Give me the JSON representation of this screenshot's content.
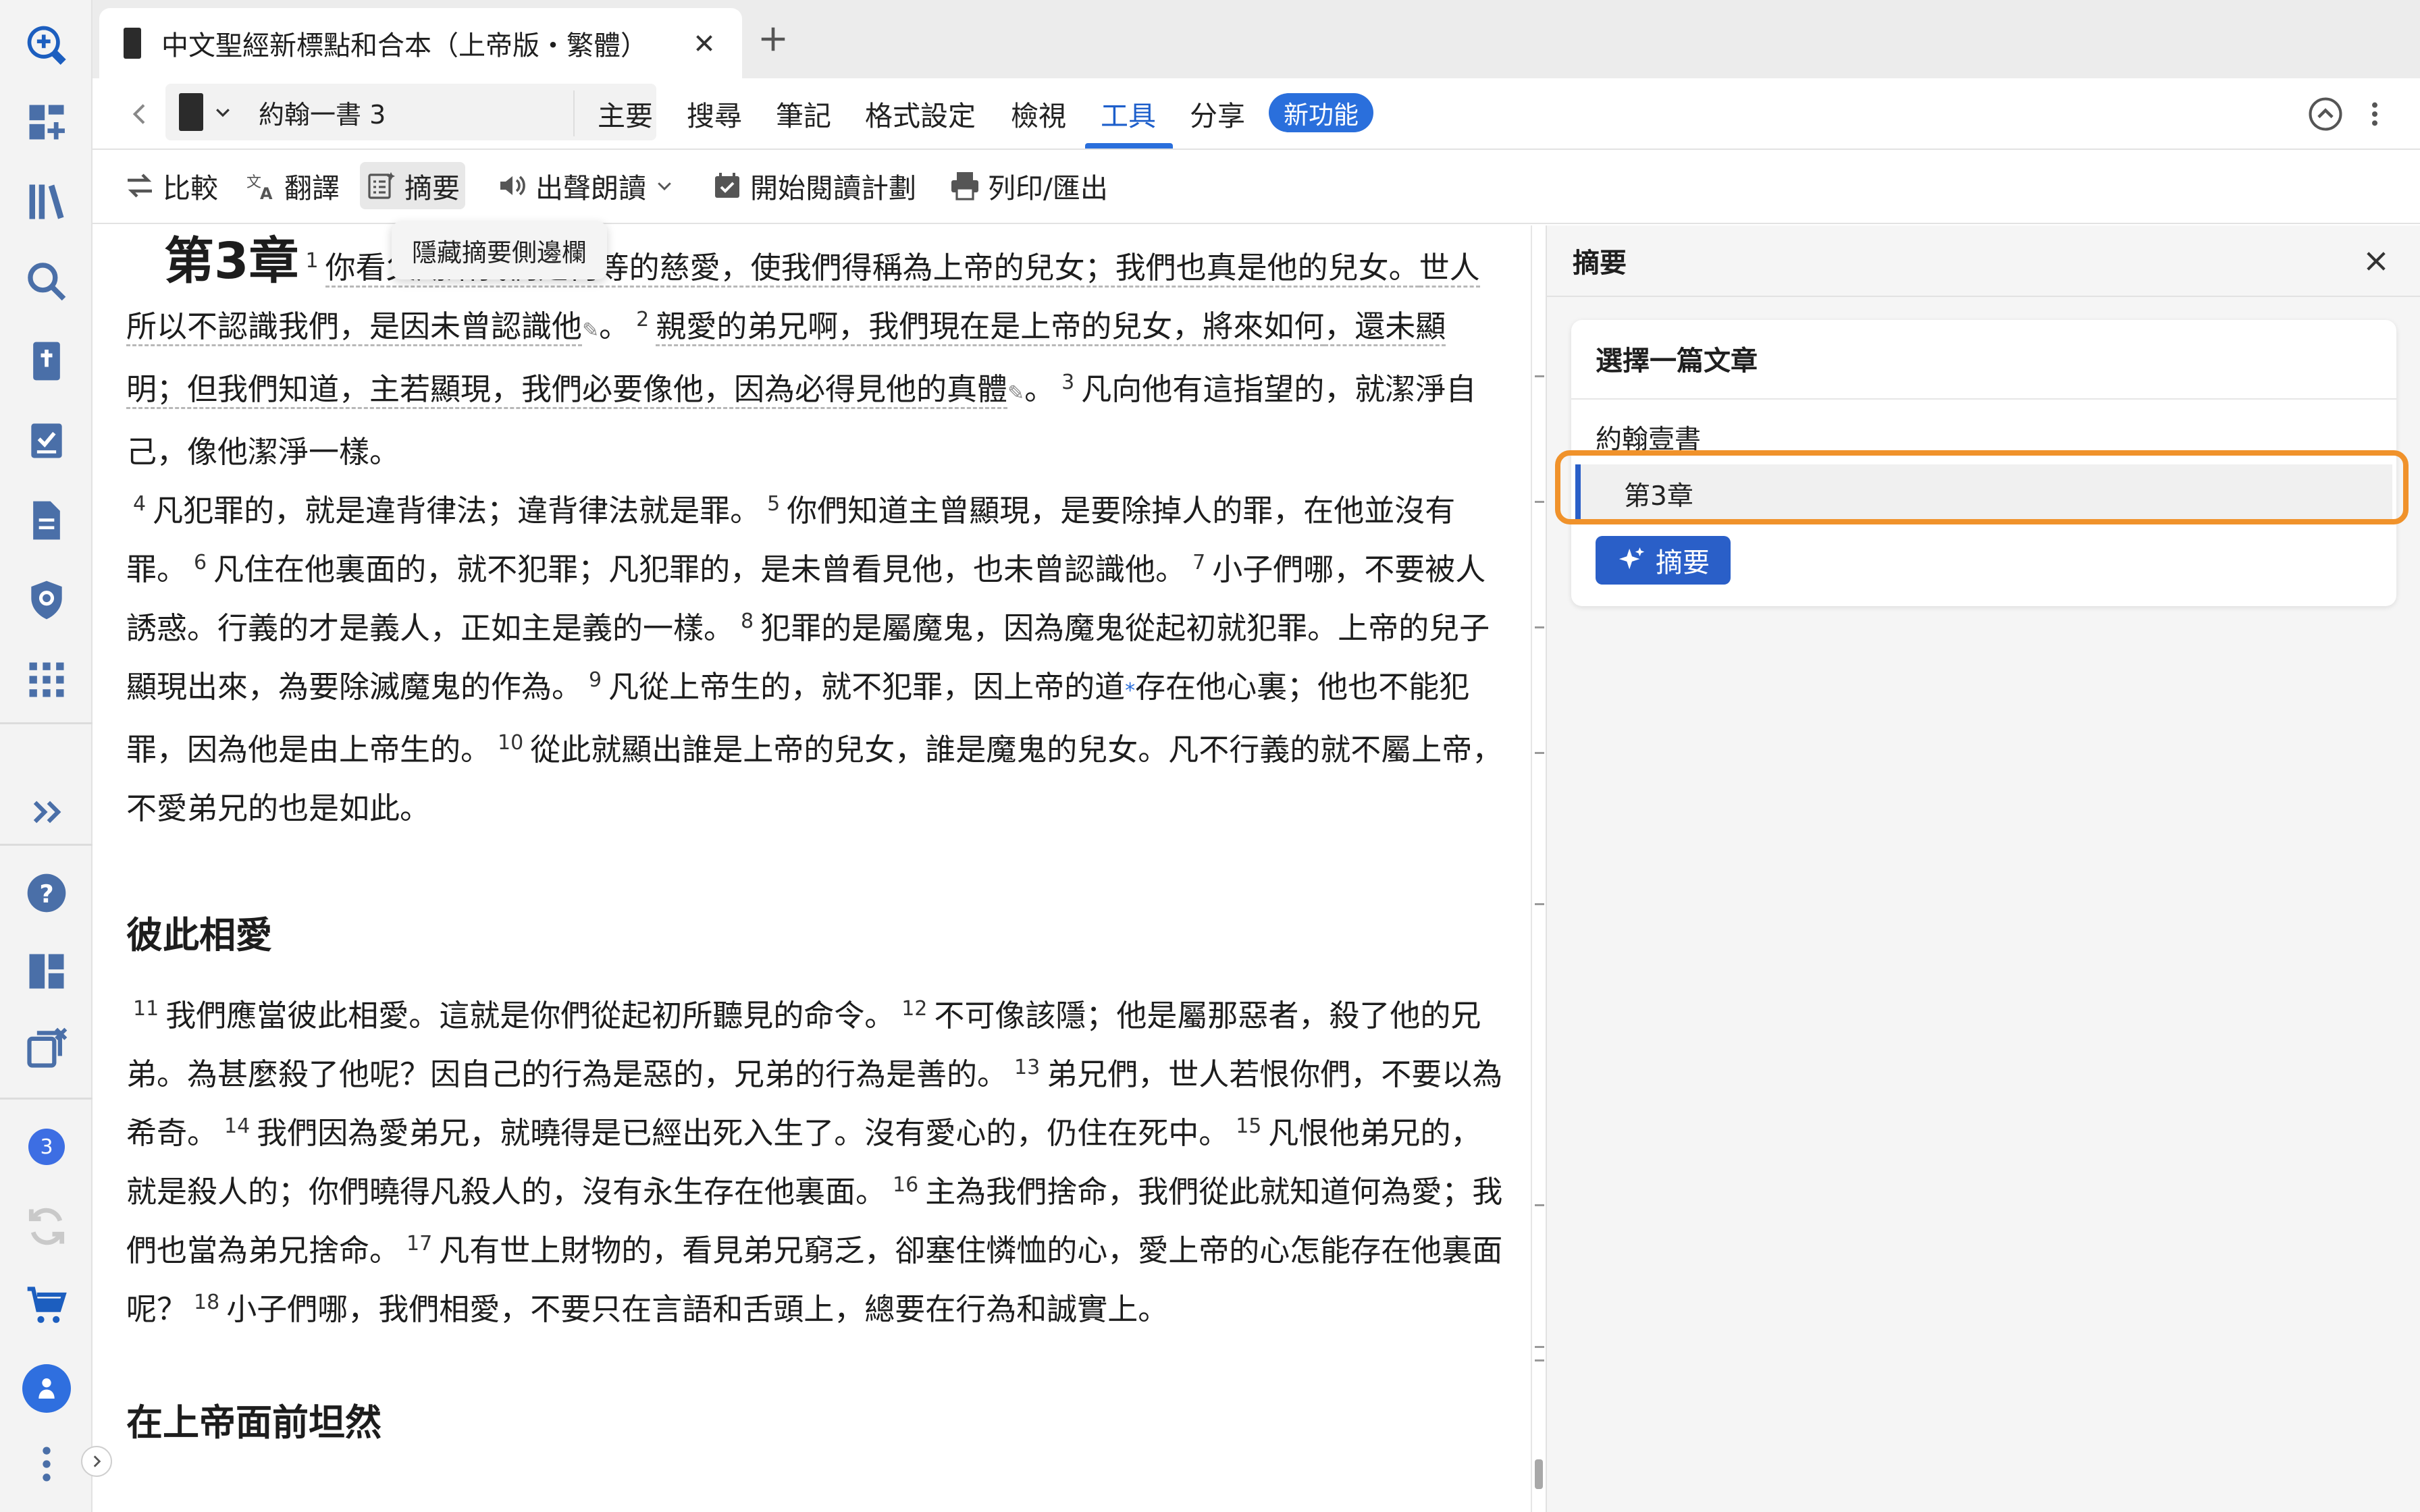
{
  "app": {
    "tab": {
      "title": "中文聖經新標點和合本（上帝版・繁體）"
    },
    "rail": {
      "badge_count": "3"
    }
  },
  "nav": {
    "reference": "約翰一書 3",
    "menu": [
      "主要",
      "搜尋",
      "筆記",
      "格式設定",
      "檢視",
      "工具",
      "分享"
    ],
    "active_menu": "工具",
    "new_badge": "新功能"
  },
  "tools": {
    "compare": "比較",
    "translate": "翻譯",
    "summary": "摘要",
    "read_aloud": "出聲朗讀",
    "reading_plan": "開始閱讀計劃",
    "print_export": "列印/匯出",
    "tooltip": "隱藏摘要側邊欄"
  },
  "reading": {
    "chapter_heading": "第3章",
    "p1": {
      "v1_num": "1",
      "v1_text": "你看父賜給我們是何等的慈愛，使我們得稱為上帝的兒女；我們也真是他的兒女。",
      "v1_cont": "世人所以不認識我們，是因未曾認識他",
      "v1_end": "。",
      "v2_num": "2",
      "v2_text": "親愛的弟兄啊，我們現在是上帝的兒女，將來如何",
      "v2_cont": "，還未顯明；但我們知道，主若顯現，我們必要像他，因為必得見他的真體",
      "v2_end": "。",
      "v3_num": "3",
      "v3_text": "凡向他有這指望的，就潔淨自己，像他潔淨一樣。"
    },
    "p2": {
      "v4_num": "4",
      "v4_text": "凡犯罪的，就是違背律法；違背律法就是罪。",
      "v5_num": "5",
      "v5_text": "你們知道主曾顯現，是要除掉人的罪，在他並沒有罪。",
      "v6_num": "6",
      "v6_text": "凡住在他裏面的，就不犯罪；凡犯罪的，是未曾看見他，也未曾認識他。",
      "v7_num": "7",
      "v7_text": "小子們哪，不要被人誘惑。行義的才是義人，正如主是義的一樣。",
      "v8_num": "8",
      "v8_text": "犯罪的是屬魔鬼，因為魔鬼從起初就犯罪。上帝的兒子顯現出來，為要除滅魔鬼的作為。",
      "v9_num": "9",
      "v9_text_a": "凡從上帝生的，就不犯罪，因上帝的道",
      "v9_text_b": "存在他心裏；他也不能犯罪，因為他是由上帝生的。",
      "v10_num": "10",
      "v10_text": "從此就顯出誰是上帝的兒女，誰是魔鬼的兒女。凡不行義的就不屬上帝，不愛弟兄的也是如此。"
    },
    "section_heading": "彼此相愛",
    "p3": {
      "v11_num": "11",
      "v11_text": "我們應當彼此相愛。這就是你們從起初所聽見的命令。",
      "v12_num": "12",
      "v12_text": "不可像該隱；他是屬那惡者，殺了他的兄弟。為甚麼殺了他呢？因自己的行為是惡的，兄弟的行為是善的。",
      "v13_num": "13",
      "v13_text": "弟兄們，世人若恨你們，不要以為希奇。",
      "v14_num": "14",
      "v14_text": "我們因為愛弟兄，就曉得是已經出死入生了。沒有愛心的，仍住在死中。",
      "v15_num": "15",
      "v15_text": "凡恨他弟兄的，就是殺人的；你們曉得凡殺人的，沒有永生存在他裏面。",
      "v16_num": "16",
      "v16_text": "主為我們捨命，我們從此就知道何為愛；我們也當為弟兄捨命。",
      "v17_num": "17",
      "v17_text": "凡有世上財物的，看見弟兄窮乏，卻塞住憐恤的心，愛上帝的心怎能存在他裏面呢？",
      "v18_num": "18",
      "v18_text": "小子們哪，我們相愛，不要只在言語和舌頭上，總要在行為和誠實上。"
    },
    "next_heading_partial": "在上帝面前坦然"
  },
  "sidebar": {
    "title": "摘要",
    "card_title": "選擇一篇文章",
    "book": "約翰壹書",
    "chapter": "第3章",
    "summarize_button": "摘要"
  },
  "colors": {
    "accent": "#2a6fdc",
    "highlight_ring": "#f0922b",
    "rail_icon": "#1c5ebf"
  }
}
